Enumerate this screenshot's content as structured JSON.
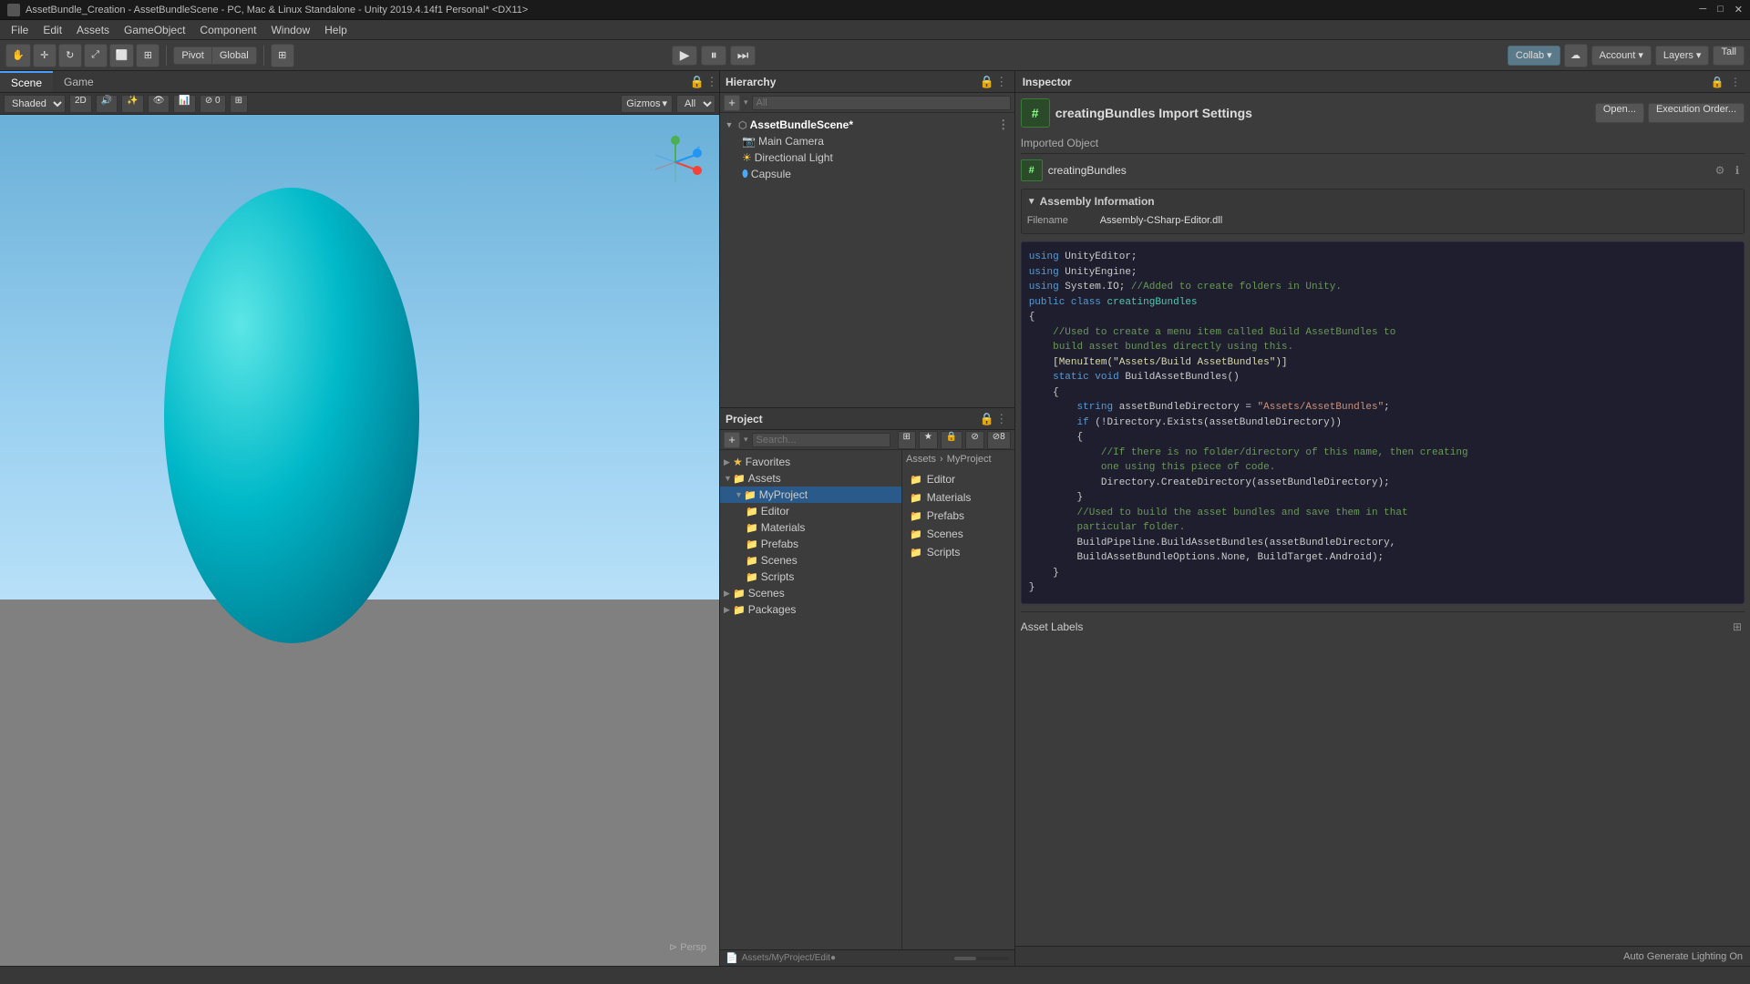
{
  "titleBar": {
    "text": "AssetBundle_Creation - AssetBundleScene - PC, Mac & Linux Standalone - Unity 2019.4.14f1 Personal* <DX11>"
  },
  "menuBar": {
    "items": [
      "File",
      "Edit",
      "Assets",
      "GameObject",
      "Component",
      "Window",
      "Help"
    ]
  },
  "toolbar": {
    "pivot": "Pivot",
    "global": "Global",
    "playBtn": "▶",
    "pauseBtn": "⏸",
    "stepBtn": "⏭",
    "collab": "Collab",
    "account": "Account",
    "layers": "Layers",
    "layout": "Tall"
  },
  "viewport": {
    "tabs": [
      "Scene",
      "Game"
    ],
    "activeTab": "Scene",
    "shading": "Shaded",
    "mode2D": "2D",
    "gizmos": "Gizmos",
    "all": "All",
    "perspLabel": "⊳ Persp"
  },
  "hierarchy": {
    "title": "Hierarchy",
    "searchPlaceholder": "All",
    "scene": "AssetBundleScene*",
    "items": [
      {
        "name": "Main Camera",
        "type": "camera",
        "indent": 1
      },
      {
        "name": "Directional Light",
        "type": "light",
        "indent": 1
      },
      {
        "name": "Capsule",
        "type": "capsule",
        "indent": 1
      }
    ]
  },
  "project": {
    "title": "Project",
    "tree": {
      "favorites": "Favorites",
      "assets": "Assets",
      "myProject": "MyProject",
      "folders": [
        "Editor",
        "Materials",
        "Prefabs",
        "Scenes",
        "Scripts"
      ],
      "scenes": "Scenes",
      "packages": "Packages"
    },
    "files": [
      {
        "name": "Editor",
        "type": "folder"
      },
      {
        "name": "Materials",
        "type": "folder"
      },
      {
        "name": "Prefabs",
        "type": "folder"
      },
      {
        "name": "Scenes",
        "type": "folder"
      },
      {
        "name": "Scripts",
        "type": "folder"
      }
    ],
    "status": "Assets/MyProject/Edit●"
  },
  "inspector": {
    "title": "Inspector",
    "scriptName": "creatingBundles Import Settings",
    "openBtn": "Open...",
    "executionOrderBtn": "Execution Order...",
    "importedObjectLabel": "Imported Object",
    "importedObjectName": "creatingBundles",
    "assemblyInfo": {
      "title": "Assembly Information",
      "filename": "Filename",
      "filenameValue": "Assembly-CSharp-Editor.dll"
    },
    "code": "using UnityEditor;\nusing UnityEngine;\nusing System.IO; //Added to create folders in Unity.\npublic class creatingBundles\n{\n    //Used to create a menu item called Build AssetBundles to\n    build asset bundles directly using this.\n    [MenuItem(\"Assets/Build AssetBundles\")]\n    static void BuildAssetBundles()\n    {\n        string assetBundleDirectory = \"Assets/AssetBundles\";\n        if (!Directory.Exists(assetBundleDirectory))\n        {\n            //If there is no folder/directory of this name, then creating\n            one using this piece of code.\n            Directory.CreateDirectory(assetBundleDirectory);\n        }\n        //Used to build the asset bundles and save them in that\n        particular folder.\n        BuildPipeline.BuildAssetBundles(assetBundleDirectory,\n        BuildAssetBundleOptions.None, BuildTarget.Android);\n    }\n}",
    "assetLabels": "Asset Labels",
    "autoGenerateLighting": "Auto Generate Lighting On"
  }
}
